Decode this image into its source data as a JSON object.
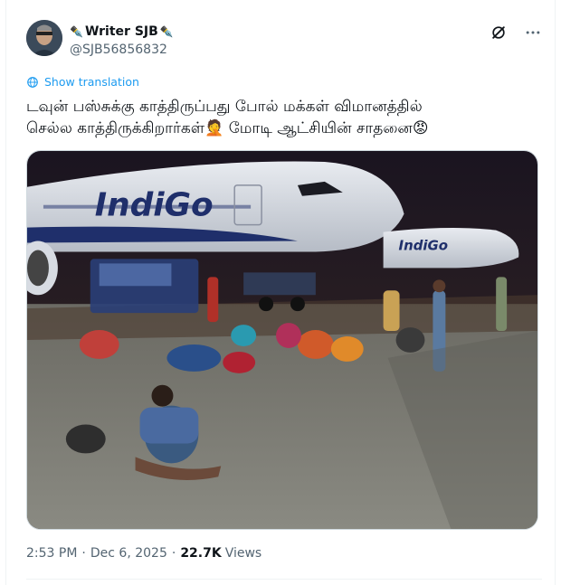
{
  "tweet": {
    "author": {
      "name": "Writer SJB",
      "handle": "@SJB56856832",
      "name_prefix_icon": "fountain-pen-icon",
      "name_suffix_icon": "fountain-pen-icon",
      "pen_glyph": "✒️"
    },
    "actions": {
      "grok_icon": "grok-icon",
      "more_icon": "more-horizontal-icon"
    },
    "translation_link": "Show translation",
    "text_line1": "டவுன் பஸ்சுக்கு காத்திருப்பது போல் மக்கள் விமானத்தில்",
    "text_line2_part1": "செல்ல காத்திருக்கிறார்கள்",
    "emoji_person": "🤦",
    "text_line2_part2": " மோடி ஆட்சியின் சாதனை",
    "emoji_angry": "😡",
    "image_brand_text": "IndiGo",
    "image_brand_text_2": "IndiGo",
    "time": "2:53 PM",
    "separator": "·",
    "date": "Dec 6, 2025",
    "views_count": "22.7K",
    "views_label": "Views",
    "colors": {
      "link": "#1d9bf0",
      "text": "#0f1419",
      "secondary": "#536471",
      "border": "#eff3f4"
    }
  }
}
